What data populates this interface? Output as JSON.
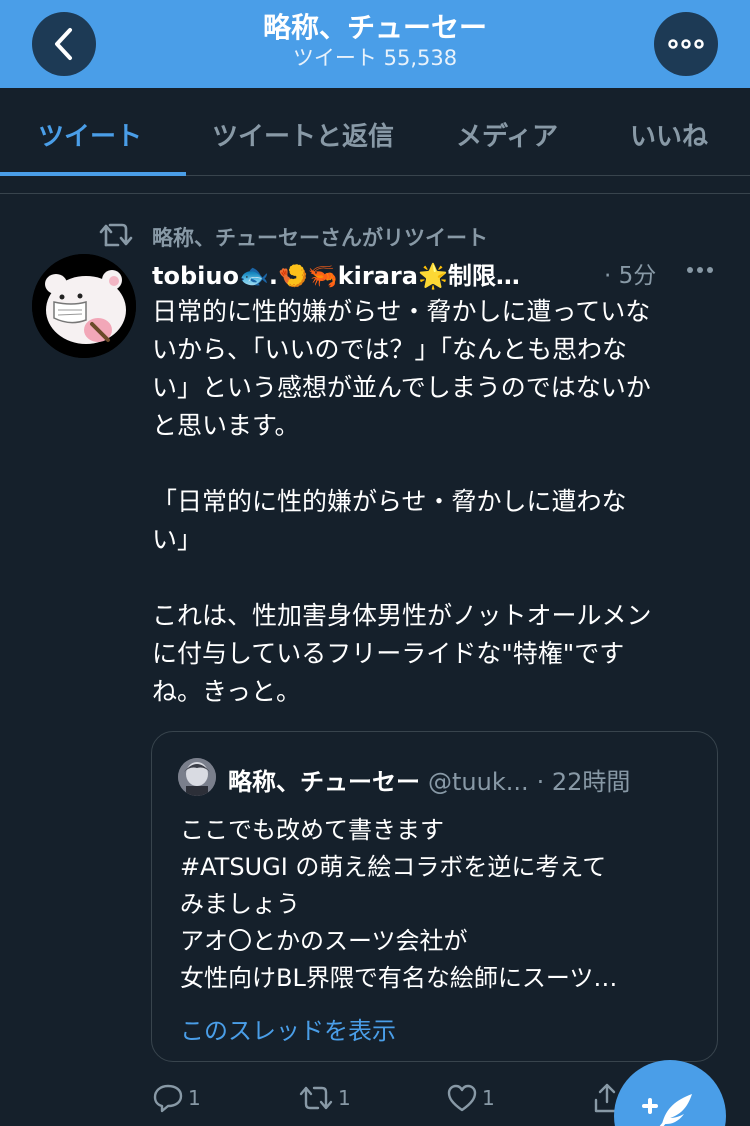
{
  "header": {
    "title": "略称、チューセー",
    "subtitle": "ツイート 55,538"
  },
  "tabs": [
    "ツイート",
    "ツイートと返信",
    "メディア",
    "いいね"
  ],
  "tweet": {
    "retweet_label": "略称、チューセーさんがリツイート",
    "author_name": "tobiuo🐟.🍤🦐kirara🌟制限…",
    "time": "· 5分",
    "lines": [
      "日常的に性的嫌がらせ・脅かしに遭っていな",
      "いから、「いいのでは？」「なんとも思わな",
      "い」という感想が並んでしまうのではないか",
      "と思います。",
      "",
      "「日常的に性的嫌がらせ・脅かしに遭わな",
      "い」",
      "",
      "これは、性加害身体男性がノットオールメン",
      "に付与しているフリーライドな\"特権\"です",
      "ね。きっと。"
    ],
    "quote": {
      "name": "略称、チューセー",
      "handle": "@tuuk...",
      "time": "· 22時間",
      "lines": [
        "ここでも改めて書きます",
        "#ATSUGI の萌え絵コラボを逆に考えて",
        "みましょう",
        "アオ〇とかのスーツ会社が",
        "女性向けBL界隈で有名な絵師にスーツ…"
      ],
      "thread_link": "このスレッドを表示"
    },
    "actions": {
      "reply_count": "1",
      "retweet_count": "1",
      "like_count": "1"
    }
  },
  "colors": {
    "background": "#15202b",
    "accent": "#4a9ee8",
    "muted": "#8899a6",
    "border": "#38444d"
  }
}
